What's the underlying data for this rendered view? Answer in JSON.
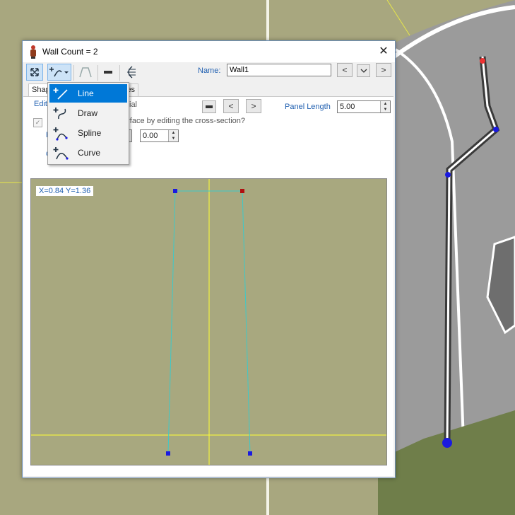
{
  "window": {
    "title": "Wall Count = 2",
    "close_icon": "close-icon"
  },
  "toolbar": {
    "buttons": [
      "select-icon",
      "shape-tool-icon",
      "profile-icon",
      "flat-icon",
      "curve-sections-icon"
    ],
    "name_label": "Name:",
    "name_value": "Wall1"
  },
  "tabs": {
    "shape": "Shap",
    "props": "ies"
  },
  "menu": {
    "items": [
      {
        "label": "Line",
        "icon": "line-icon",
        "selected": true
      },
      {
        "label": "Draw",
        "icon": "draw-icon",
        "selected": false
      },
      {
        "label": "Spline",
        "icon": "spline-icon",
        "selected": false
      },
      {
        "label": "Curve",
        "icon": "curve-icon",
        "selected": false
      }
    ]
  },
  "content": {
    "edit_link": "Edit",
    "ial_text": "ial",
    "question_text": "urface by editing the cross-section?",
    "panel_length_label": "Panel Length",
    "panel_length_value": "5.00",
    "offset_value": "0.00",
    "r_label": "R",
    "c_label": "C"
  },
  "canvas": {
    "coord_readout": "X=0.84 Y=1.36",
    "background": "#a8a87f",
    "line_color": "#3ec9c9",
    "axis_color": "#ffff33"
  },
  "colors": {
    "accent": "#0078d7",
    "link": "#1f5fb0"
  }
}
